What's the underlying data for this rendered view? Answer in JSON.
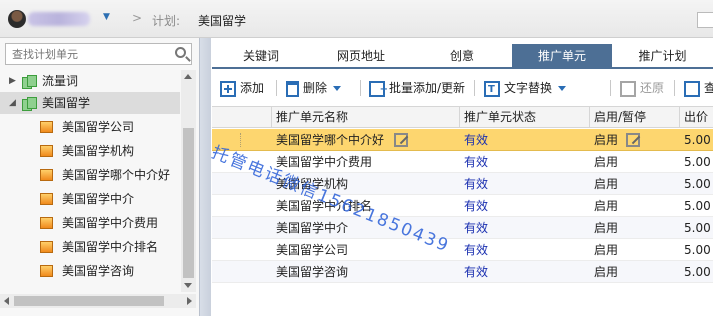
{
  "header": {
    "crumb_separator": ">",
    "plan_label": "计划:",
    "plan_value": "美国留学"
  },
  "sidebar": {
    "search": {
      "placeholder": "查找计划单元",
      "value": ""
    },
    "plans": [
      {
        "label": "流量词",
        "expanded": false
      },
      {
        "label": "美国留学",
        "expanded": true,
        "selected": true
      }
    ],
    "units": [
      "美国留学公司",
      "美国留学机构",
      "美国留学哪个中介好",
      "美国留学中介",
      "美国留学中介费用",
      "美国留学中介排名",
      "美国留学咨询"
    ]
  },
  "tabs": [
    {
      "label": "关键词",
      "active": false
    },
    {
      "label": "网页地址",
      "active": false
    },
    {
      "label": "创意",
      "active": false
    },
    {
      "label": "推广单元",
      "active": true
    },
    {
      "label": "推广计划",
      "active": false
    }
  ],
  "toolbar": {
    "add": "添加",
    "delete": "删除",
    "batch": "批量添加/更新",
    "replace": "文字替换",
    "restore": "还原",
    "more": "查"
  },
  "table": {
    "columns": [
      "推广单元名称",
      "推广单元状态",
      "启用/暂停",
      "出价"
    ],
    "rows": [
      {
        "name": "美国留学哪个中介好",
        "status": "有效",
        "enable": "启用",
        "bid": "5.00",
        "selected": true
      },
      {
        "name": "美国留学中介费用",
        "status": "有效",
        "enable": "启用",
        "bid": "5.00"
      },
      {
        "name": "美国留学机构",
        "status": "有效",
        "enable": "启用",
        "bid": "5.00"
      },
      {
        "name": "美国留学中介排名",
        "status": "有效",
        "enable": "启用",
        "bid": "5.00"
      },
      {
        "name": "美国留学中介",
        "status": "有效",
        "enable": "启用",
        "bid": "5.00"
      },
      {
        "name": "美国留学公司",
        "status": "有效",
        "enable": "启用",
        "bid": "5.00"
      },
      {
        "name": "美国留学咨询",
        "status": "有效",
        "enable": "启用",
        "bid": "5.00"
      }
    ]
  },
  "watermark": "托管电话微信15621850439",
  "colors": {
    "tab_active": "#4d6f95",
    "selected_row": "#fdd66f",
    "status_text": "#1a2fb0",
    "toolbar_icon": "#2a6db5"
  }
}
